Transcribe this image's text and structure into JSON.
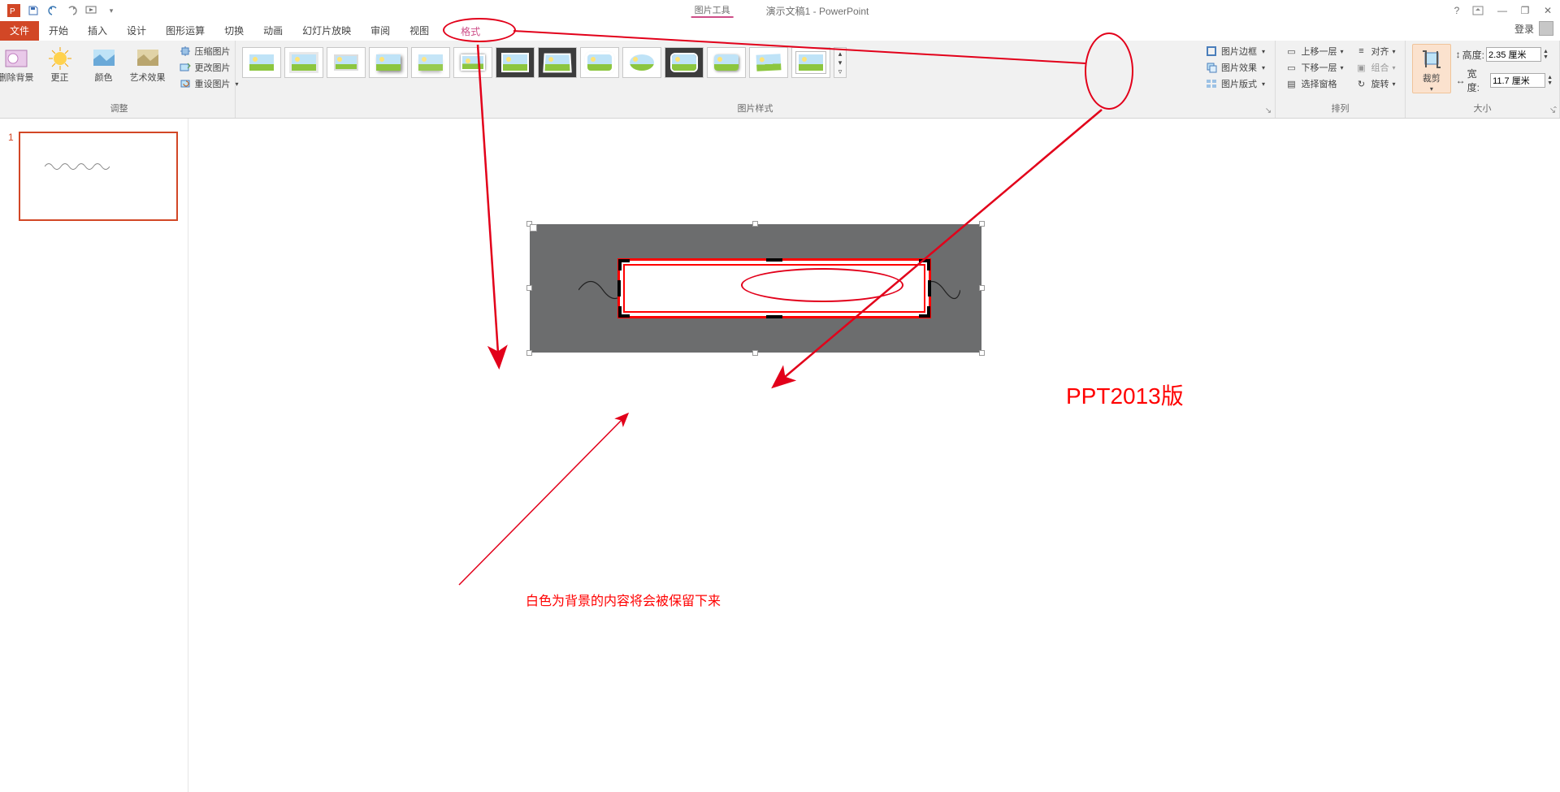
{
  "titlebar": {
    "context_tool": "图片工具",
    "doc_title": "演示文稿1 - PowerPoint",
    "help": "?",
    "ribbon_opts": "▢",
    "min": "—",
    "restore": "❐",
    "close": "✕"
  },
  "tabs": {
    "file": "文件",
    "home": "开始",
    "insert": "插入",
    "design": "设计",
    "shape_calc": "图形运算",
    "transitions": "切换",
    "animations": "动画",
    "slideshow": "幻灯片放映",
    "review": "审阅",
    "view": "视图",
    "format": "格式",
    "login": "登录"
  },
  "ribbon": {
    "adjust": {
      "remove_bg": "删除背景",
      "corrections": "更正",
      "color": "颜色",
      "artistic": "艺术效果",
      "compress": "压缩图片",
      "change": "更改图片",
      "reset": "重设图片",
      "group_label": "调整"
    },
    "styles": {
      "group_label": "图片样式",
      "border": "图片边框",
      "effects": "图片效果",
      "layout": "图片版式"
    },
    "arrange": {
      "bring_forward": "上移一层",
      "send_backward": "下移一层",
      "selection_pane": "选择窗格",
      "align": "对齐",
      "group": "组合",
      "rotate": "旋转",
      "group_label": "排列"
    },
    "size": {
      "crop": "裁剪",
      "height_label": "高度:",
      "height_value": "2.35 厘米",
      "width_label": "宽度:",
      "width_value": "11.7 厘米",
      "group_label": "大小"
    }
  },
  "thumb": {
    "num": "1"
  },
  "annotations": {
    "caption": "白色为背景的内容将会被保留下来",
    "version": "PPT2013版"
  }
}
